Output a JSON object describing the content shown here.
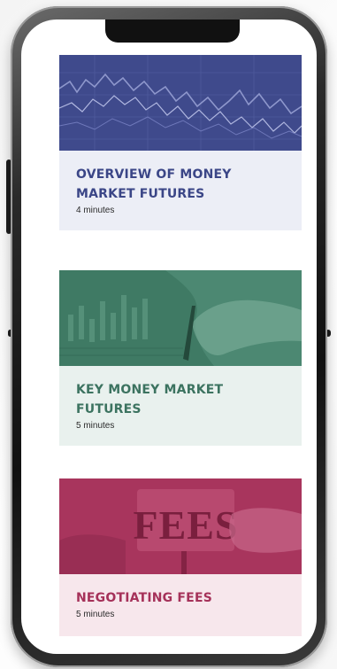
{
  "courses": [
    {
      "title": "OVERVIEW OF MONEY MARKET FUTURES",
      "duration": "4 minutes",
      "image_icon": "stock-chart-image",
      "accent_color": "#3f4a8c"
    },
    {
      "title": "KEY MONEY MARKET FUTURES",
      "duration": "5 minutes",
      "image_icon": "trading-hand-image",
      "accent_color": "#3f7a64"
    },
    {
      "title": "NEGOTIATING FEES",
      "duration": "5 minutes",
      "image_icon": "fees-sign-image",
      "image_text": "FEES",
      "accent_color": "#a8355d"
    }
  ]
}
